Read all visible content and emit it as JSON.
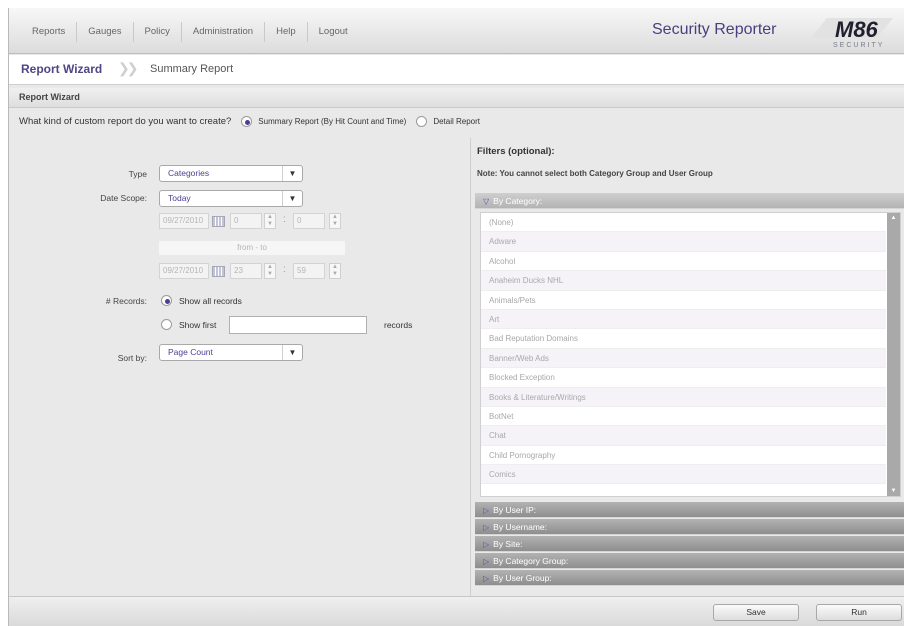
{
  "nav": {
    "items": [
      "Reports",
      "Gauges",
      "Policy",
      "Administration",
      "Help",
      "Logout"
    ],
    "brand": "Security Reporter",
    "logo_text": "M86 SECURITY"
  },
  "breadcrumb": {
    "current": "Report Wizard",
    "next": "Summary Report"
  },
  "wizard": {
    "section_title": "Report Wizard",
    "question": "What kind of custom report do you want to create?",
    "options": [
      {
        "label": "Summary Report (By Hit Count and Time)",
        "selected": true
      },
      {
        "label": "Detail Report",
        "selected": false
      }
    ]
  },
  "form": {
    "type_label": "Type",
    "type_value": "Categories",
    "date_scope_label": "Date Scope:",
    "date_scope_value": "Today",
    "from_date": "09/27/2010",
    "from_hour": "0",
    "from_min": "0",
    "from_to_label": "from - to",
    "to_date": "09/27/2010",
    "to_hour": "23",
    "to_min": "59",
    "colon": ":",
    "records_label": "# Records:",
    "show_all_label": "Show all records",
    "show_first_label": "Show first",
    "show_first_value": "",
    "records_suffix": "records",
    "sort_label": "Sort by:",
    "sort_value": "Page Count"
  },
  "filters": {
    "title": "Filters (optional):",
    "note": "Note: You cannot select both Category Group and User Group",
    "by_category": "By Category:",
    "categories": [
      "(None)",
      "Adware",
      "Alcohol",
      "Anaheim Ducks NHL",
      "Animals/Pets",
      "Art",
      "Bad Reputation Domains",
      "Banner/Web Ads",
      "Blocked Exception",
      "Books & Literature/Writings",
      "BotNet",
      "Chat",
      "Child Pornography",
      "Comics"
    ],
    "sections": [
      "By User IP:",
      "By Username:",
      "By Site:",
      "By Category Group:",
      "By User Group:"
    ]
  },
  "actions": {
    "save": "Save",
    "run": "Run"
  },
  "colors": {
    "accent": "#4b3f92",
    "brand": "#4a3f7e"
  }
}
